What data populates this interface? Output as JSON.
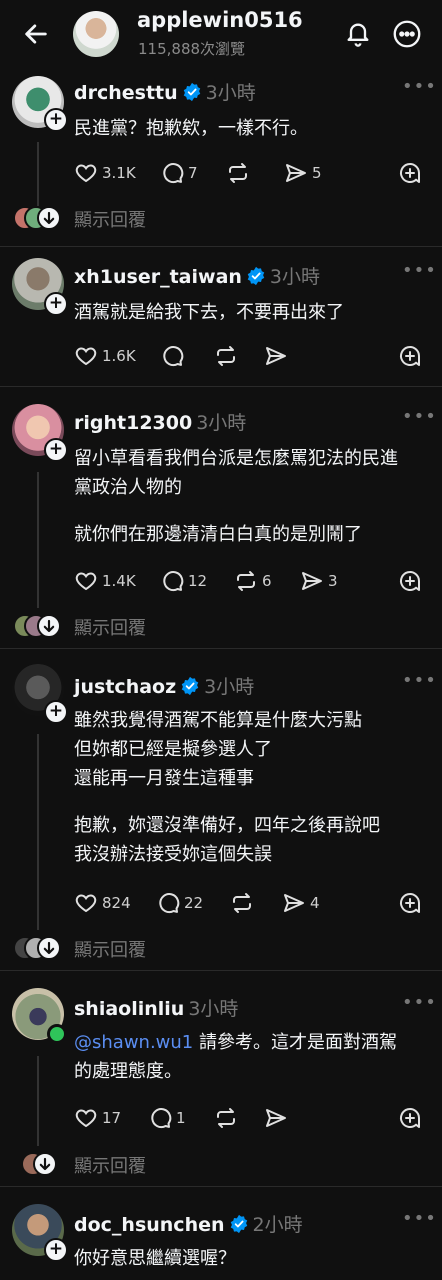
{
  "header": {
    "username": "applewin0516",
    "views": "115,888次瀏覽"
  },
  "posts": [
    {
      "username": "drchesttu",
      "verified": true,
      "time": "3小時",
      "lines": [
        "民進黨？抱歉欸，一樣不行。"
      ],
      "likes": "3.1K",
      "comments": "7",
      "reposts": "",
      "shares": "5",
      "show_replies": "顯示回覆"
    },
    {
      "username": "xh1user_taiwan",
      "verified": true,
      "time": "3小時",
      "lines": [
        "酒駕就是給我下去，不要再出來了"
      ],
      "likes": "1.6K",
      "comments": "",
      "reposts": "",
      "shares": ""
    },
    {
      "username": "right12300",
      "verified": false,
      "time": "3小時",
      "lines": [
        "留小草看看我們台派是怎麼罵犯法的民進",
        "黨政治人物的"
      ],
      "lines2": [
        "就你們在那邊清清白白真的是別鬧了"
      ],
      "likes": "1.4K",
      "comments": "12",
      "reposts": "6",
      "shares": "3",
      "show_replies": "顯示回覆"
    },
    {
      "username": "justchaoz",
      "verified": true,
      "time": "3小時",
      "lines": [
        "雖然我覺得酒駕不能算是什麼大污點",
        "但妳都已經是擬參選人了",
        "還能再一月發生這種事"
      ],
      "lines2": [
        "抱歉，妳還沒準備好，四年之後再說吧",
        "我沒辦法接受妳這個失誤"
      ],
      "likes": "824",
      "comments": "22",
      "reposts": "",
      "shares": "4",
      "show_replies": "顯示回覆"
    },
    {
      "username": "shiaolinliu",
      "verified": false,
      "time": "3小時",
      "mention": "@shawn.wu1",
      "lines": [
        " 請參考。這才是面對酒駕",
        "的處理態度。"
      ],
      "likes": "17",
      "comments": "1",
      "reposts": "",
      "shares": "",
      "show_replies": "顯示回覆"
    },
    {
      "username": "doc_hsunchen",
      "verified": true,
      "time": "2小時",
      "lines": [
        "你好意思繼續選喔？"
      ]
    }
  ],
  "colors": {
    "background": "#101010",
    "text": "#f3f5f7",
    "muted": "#777777",
    "verified": "#0095f6",
    "mention": "#5b8ef2"
  }
}
